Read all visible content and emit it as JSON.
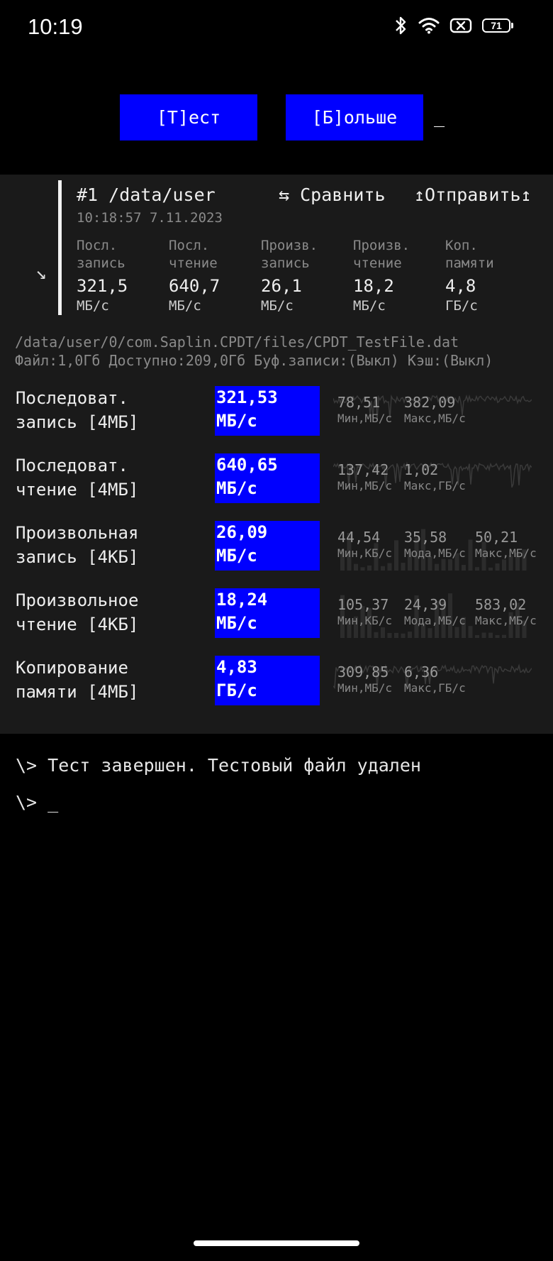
{
  "status_bar": {
    "time": "10:19",
    "battery": "71"
  },
  "toolbar": {
    "test_label": "[Т]ест",
    "more_label": "[Б]ольше",
    "cursor": "_"
  },
  "summary": {
    "arrow": "↘",
    "title": "#1 /data/user",
    "compare_label": "⇆ Сравнить",
    "send_label": "↥Отправить↥",
    "datetime": "10:18:57 7.11.2023",
    "metrics": [
      {
        "label_line1": "Посл.",
        "label_line2": "запись",
        "value": "321,5",
        "unit": "МБ/с"
      },
      {
        "label_line1": "Посл.",
        "label_line2": "чтение",
        "value": "640,7",
        "unit": "МБ/с"
      },
      {
        "label_line1": "Произв.",
        "label_line2": "запись",
        "value": "26,1",
        "unit": "МБ/с"
      },
      {
        "label_line1": "Произв.",
        "label_line2": "чтение",
        "value": "18,2",
        "unit": "МБ/с"
      },
      {
        "label_line1": "Коп.",
        "label_line2": "памяти",
        "value": "4,8",
        "unit": "ГБ/с"
      }
    ]
  },
  "file": {
    "path": "/data/user/0/com.Saplin.CPDT/files/CPDT_TestFile.dat",
    "info": "Файл:1,0Гб Доступно:209,0Гб Буф.записи:(Выкл) Кэш:(Выкл)"
  },
  "tests": [
    {
      "label_line1": "Последоват.",
      "label_line2": "запись [4МБ]",
      "result_value": "321,53",
      "result_unit": "МБ/с",
      "stats": [
        {
          "value": "78,51",
          "label": "Мин,МБ/с"
        },
        {
          "value": "382,09",
          "label": "Макс,МБ/с"
        }
      ]
    },
    {
      "label_line1": "Последоват.",
      "label_line2": "чтение [4МБ]",
      "result_value": "640,65",
      "result_unit": "МБ/с",
      "stats": [
        {
          "value": "137,42",
          "label": "Мин,МБ/с"
        },
        {
          "value": "1,02",
          "label": "Макс,ГБ/с"
        }
      ]
    },
    {
      "label_line1": "Произвольная",
      "label_line2": "запись [4КБ]",
      "result_value": "26,09",
      "result_unit": "МБ/с",
      "stats": [
        {
          "value": "44,54",
          "label": "Мин,КБ/с"
        },
        {
          "value": "35,58",
          "label": "Мода,МБ/с"
        },
        {
          "value": "50,21",
          "label": "Макс,МБ/с"
        }
      ]
    },
    {
      "label_line1": "Произвольное",
      "label_line2": "чтение [4КБ]",
      "result_value": "18,24",
      "result_unit": "МБ/с",
      "stats": [
        {
          "value": "105,37",
          "label": "Мин,КБ/с"
        },
        {
          "value": "24,39",
          "label": "Мода,МБ/с"
        },
        {
          "value": "583,02",
          "label": "Макс,МБ/с"
        }
      ]
    },
    {
      "label_line1": "Копирование",
      "label_line2": "памяти [4МБ]",
      "result_value": "4,83",
      "result_unit": "ГБ/с",
      "stats": [
        {
          "value": "309,85",
          "label": "Мин,МБ/с"
        },
        {
          "value": "6,36",
          "label": "Макс,ГБ/с"
        }
      ]
    }
  ],
  "console": {
    "line1": "\\> Тест завершен. Тестовый файл удален",
    "line2": "\\> _"
  }
}
